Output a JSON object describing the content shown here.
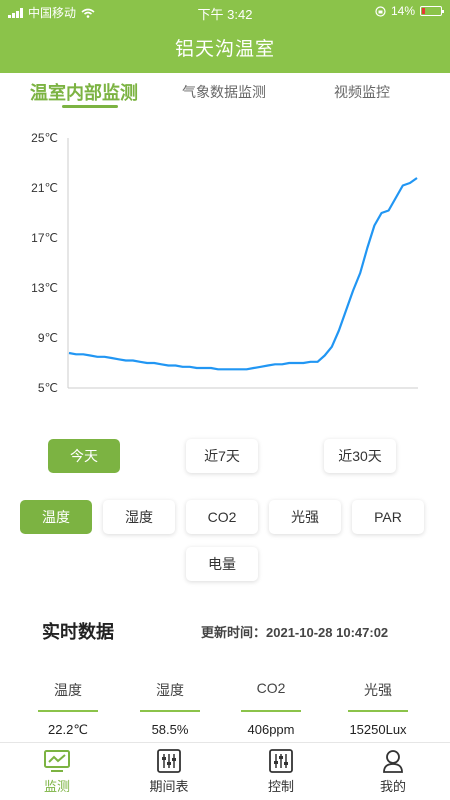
{
  "status_bar": {
    "carrier": "中国移动",
    "time": "下午 3:42",
    "battery": "14%"
  },
  "header": {
    "title": "铝天沟温室"
  },
  "tabs": [
    {
      "label": "温室内部监测",
      "active": true
    },
    {
      "label": "气象数据监测",
      "active": false
    },
    {
      "label": "视频监控",
      "active": false
    }
  ],
  "chart_data": {
    "type": "line",
    "title": "",
    "xlabel": "",
    "ylabel": "",
    "ylim": [
      5,
      25
    ],
    "yticks": [
      "25℃",
      "21℃",
      "17℃",
      "13℃",
      "9℃",
      "5℃"
    ],
    "grid": false,
    "series": [
      {
        "color": "#2196f3",
        "values": [
          7.8,
          7.7,
          7.7,
          7.6,
          7.5,
          7.5,
          7.4,
          7.3,
          7.2,
          7.2,
          7.1,
          7.0,
          7.0,
          6.9,
          6.8,
          6.8,
          6.7,
          6.7,
          6.6,
          6.6,
          6.6,
          6.5,
          6.5,
          6.5,
          6.5,
          6.5,
          6.6,
          6.7,
          6.8,
          6.9,
          6.9,
          7.0,
          7.0,
          7.0,
          7.1,
          7.1,
          7.6,
          8.3,
          9.6,
          11.2,
          12.8,
          14.2,
          16.2,
          18.0,
          19.0,
          19.2,
          20.2,
          21.2,
          21.4,
          21.8
        ]
      }
    ]
  },
  "ranges": [
    "今天",
    "近7天",
    "近30天"
  ],
  "metrics": [
    "温度",
    "湿度",
    "CO2",
    "光强",
    "PAR",
    "电量"
  ],
  "realtime": {
    "title": "实时数据",
    "update_label": "更新时间：2021-10-28 10:47:02",
    "columns": [
      {
        "label": "温度",
        "value": "22.2℃"
      },
      {
        "label": "湿度",
        "value": "58.5%"
      },
      {
        "label": "CO2",
        "value": "406ppm"
      },
      {
        "label": "光强",
        "value": "15250Lux"
      }
    ]
  },
  "nav": [
    "监测",
    "期间表",
    "控制",
    "我的"
  ],
  "colors": {
    "brand": "#8bc34a",
    "accent": "#7cb342",
    "line": "#2196f3"
  }
}
